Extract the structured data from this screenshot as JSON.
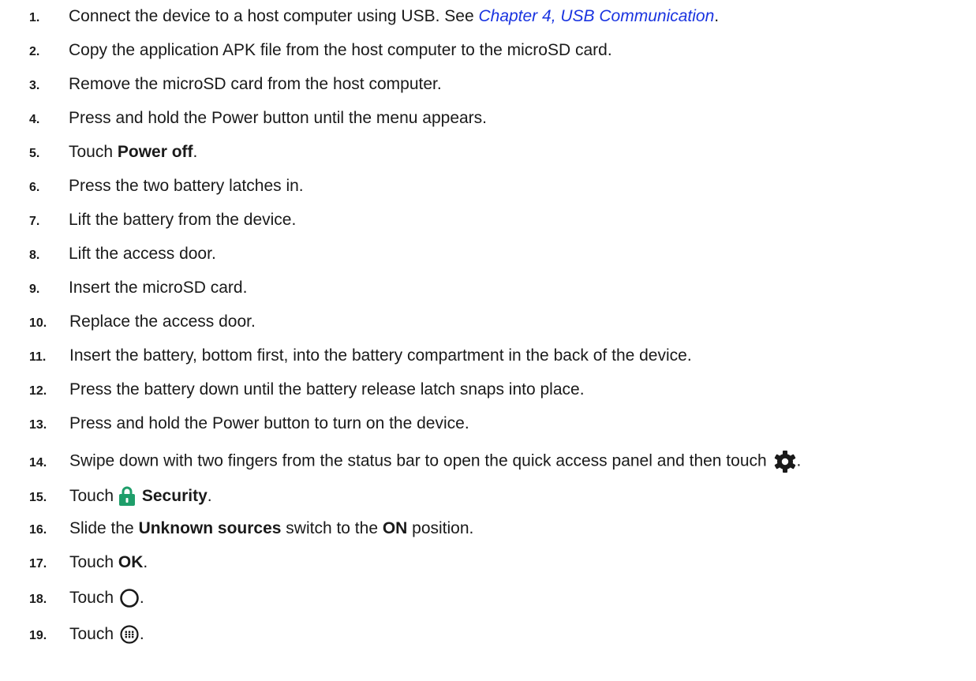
{
  "steps": [
    {
      "num": "1.",
      "pre": "Connect the device to a host computer using USB. See ",
      "link": "Chapter 4, USB Communication",
      "post": "."
    },
    {
      "num": "2.",
      "text": "Copy the application APK file from the host computer to the microSD card."
    },
    {
      "num": "3.",
      "text": "Remove the microSD card from the host computer."
    },
    {
      "num": "4.",
      "text": "Press and hold the Power button until the menu appears."
    },
    {
      "num": "5.",
      "pre": "Touch ",
      "bold": "Power off",
      "post": "."
    },
    {
      "num": "6.",
      "text": "Press the two battery latches in."
    },
    {
      "num": "7.",
      "text": "Lift the battery from the device."
    },
    {
      "num": "8.",
      "text": "Lift the access door."
    },
    {
      "num": "9.",
      "text": "Insert the microSD card."
    },
    {
      "num": "10.",
      "text": "Replace the access door."
    },
    {
      "num": "11.",
      "text": "Insert the battery, bottom first, into the battery compartment in the back of the device."
    },
    {
      "num": "12.",
      "text": "Press the battery down until the battery release latch snaps into place."
    },
    {
      "num": "13.",
      "text": "Press and hold the Power button to turn on the device."
    },
    {
      "num": "14.",
      "pre": "Swipe down with two fingers from the status bar to open the quick access panel and then touch ",
      "icon": "gear-icon",
      "post": "."
    },
    {
      "num": "15.",
      "pre": "Touch ",
      "icon": "lock-icon",
      "bold": "Security",
      "post": "."
    },
    {
      "num": "16.",
      "pre": "Slide the ",
      "bold": "Unknown sources",
      "mid": " switch to the ",
      "bold2": "ON",
      "post": " position."
    },
    {
      "num": "17.",
      "pre": "Touch ",
      "bold": "OK",
      "post": "."
    },
    {
      "num": "18.",
      "pre": "Touch ",
      "icon": "home-circle-icon",
      "post": "."
    },
    {
      "num": "19.",
      "pre": "Touch ",
      "icon": "all-apps-icon",
      "post": "."
    }
  ],
  "colors": {
    "text": "#1a1a1a",
    "link": "#1a34e0",
    "lock_icon": "#1e9e6a"
  }
}
